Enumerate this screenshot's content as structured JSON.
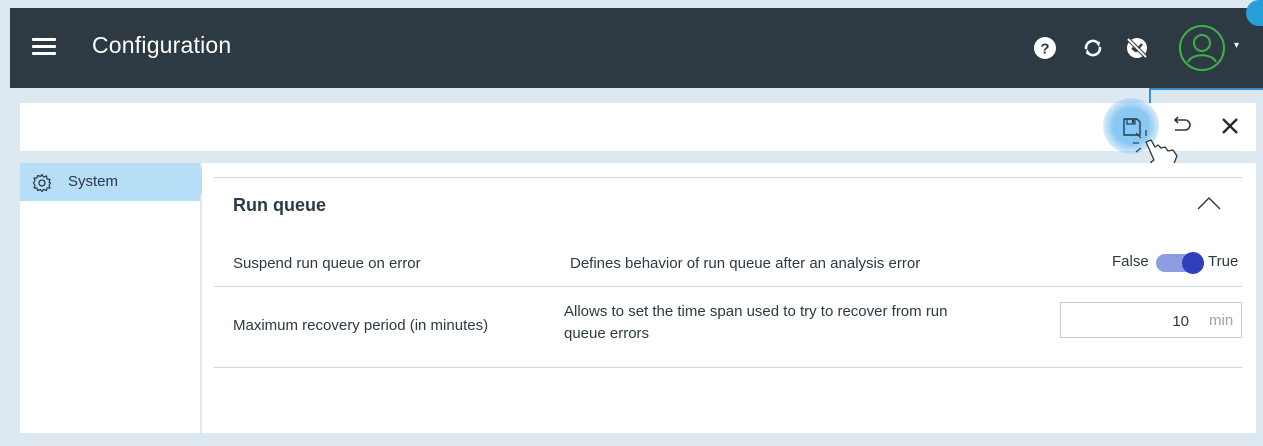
{
  "header": {
    "title": "Configuration",
    "icons": [
      "menu-icon",
      "help-icon",
      "sync-icon",
      "no-event-icon",
      "user-avatar-icon"
    ],
    "bg_color": "#2d3a44"
  },
  "toolbar": {
    "icons": [
      "save-icon",
      "undo-icon",
      "close-icon"
    ],
    "highlight_color": "#5ab0eb"
  },
  "sidebar": {
    "items": [
      {
        "label": "System",
        "icon": "gear-icon",
        "selected": true
      }
    ],
    "selected_color": "#b7def7"
  },
  "section": {
    "title": "Run queue",
    "rows": [
      {
        "name": "Suspend run queue on error",
        "description": "Defines behavior of run queue after an analysis error",
        "false_label": "False",
        "true_label": "True",
        "toggle_on": true
      },
      {
        "name": "Maximum recovery period (in minutes)",
        "description_line1": "Allows to set the time span used to try to recover from run",
        "description_line2": "queue errors",
        "value": "10",
        "unit": "min"
      }
    ]
  },
  "accent": "#2f3fbf"
}
